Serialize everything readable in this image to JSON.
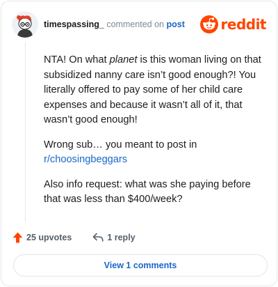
{
  "comment": {
    "username": "timespassing_",
    "action_text": "commented on",
    "target_link": "post",
    "body": {
      "p1_before": "NTA! On what ",
      "p1_em": "planet",
      "p1_after": " is this woman living on that subsidized nanny care isn’t good enough?! You literally offered to pay some of her child care expenses and because it wasn’t all of it, that wasn’t good enough!",
      "p2_text": "Wrong sub… you meant to post in ",
      "p2_link": "r/choosingbeggars",
      "p3_text": "Also info request: what was she paying before that was less than $400/week?"
    },
    "upvotes": "25 upvotes",
    "reply": "1 reply",
    "view_comments": "View 1 comments"
  },
  "brand": {
    "wordmark": "reddit",
    "icon": "reddit-snoo-icon",
    "color": "#ff4500"
  },
  "colors": {
    "link": "#1a66c9",
    "upvote": "#ff4500",
    "text": "#1c1c1c",
    "muted": "#555f69"
  },
  "icons": {
    "avatar": "user-avatar",
    "upvote": "upvote-arrow-icon",
    "reply": "reply-arrow-icon"
  }
}
